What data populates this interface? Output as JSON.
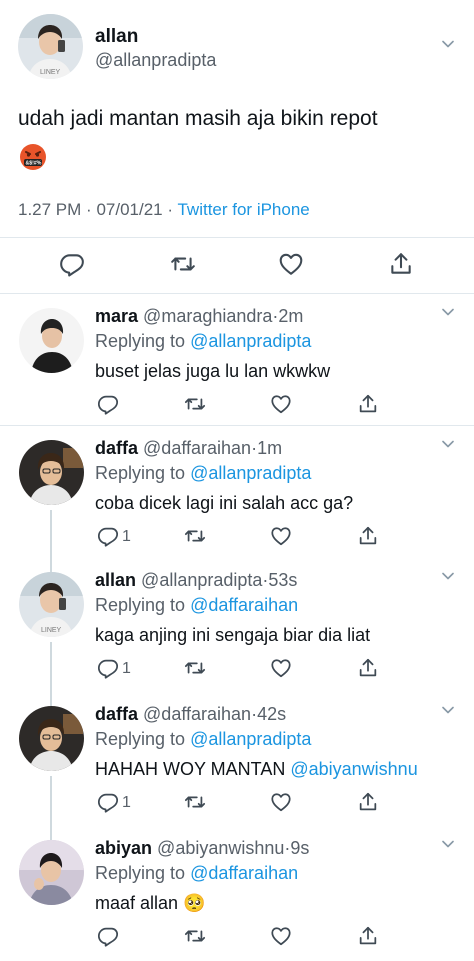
{
  "tweet": {
    "name": "allan",
    "handle": "@allanpradipta",
    "text": "udah jadi mantan masih aja bikin repot",
    "emoji": "🤬",
    "time": "1.27 PM",
    "date": "07/01/21",
    "source": "Twitter for iPhone",
    "meta_sep": "·"
  },
  "replies": [
    {
      "name": "mara",
      "handle": "@maraghiandra",
      "time": "2m",
      "reply_to": "@allanpradipta",
      "text": "buset jelas juga lu lan wkwkw",
      "reply_count": ""
    },
    {
      "name": "daffa",
      "handle": "@daffaraihan",
      "time": "1m",
      "reply_to": "@allanpradipta",
      "text": "coba dicek lagi ini salah acc ga?",
      "reply_count": "1"
    },
    {
      "name": "allan",
      "handle": "@allanpradipta",
      "time": "53s",
      "reply_to": "@daffaraihan",
      "text": "kaga anjing ini sengaja biar dia liat",
      "reply_count": "1"
    },
    {
      "name": "daffa",
      "handle": "@daffaraihan",
      "time": "42s",
      "reply_to": "@allanpradipta",
      "text_prefix": "HAHAH WOY MANTAN ",
      "text_mention": "@abiyanwishnu",
      "reply_count": "1"
    },
    {
      "name": "abiyan",
      "handle": "@abiyanwishnu",
      "time": "9s",
      "reply_to": "@daffaraihan",
      "text": "maaf allan 🥺",
      "reply_count": ""
    }
  ],
  "labels": {
    "replying_to": "Replying to",
    "dot": "·"
  },
  "colors": {
    "link": "#1b95e0",
    "muted": "#586069",
    "divider": "#e1e8ed",
    "thread_line": "#cfd9de"
  }
}
